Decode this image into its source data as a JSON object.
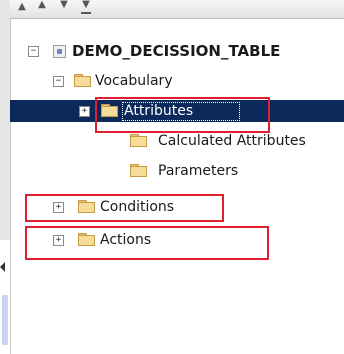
{
  "tree": {
    "root_label": "DEMO_DECISSION_TABLE",
    "vocabulary_label": "Vocabulary",
    "attributes_label": "Attributes",
    "calculated_label": "Calculated Attributes",
    "parameters_label": "Parameters",
    "conditions_label": "Conditions",
    "actions_label": "Actions",
    "collapse_glyph": "−",
    "expand_glyph": "+",
    "selected_item": "Attributes"
  },
  "icons": {
    "toolbar": [
      "collapse-all-icon",
      "move-up-icon",
      "move-down-icon",
      "expand-all-icon"
    ],
    "node": "folder-icon",
    "root": "model-icon"
  },
  "colors": {
    "selection_bg": "#0b2a5b",
    "highlight_box": "#e02030",
    "folder_fill": "#f6dc99"
  }
}
